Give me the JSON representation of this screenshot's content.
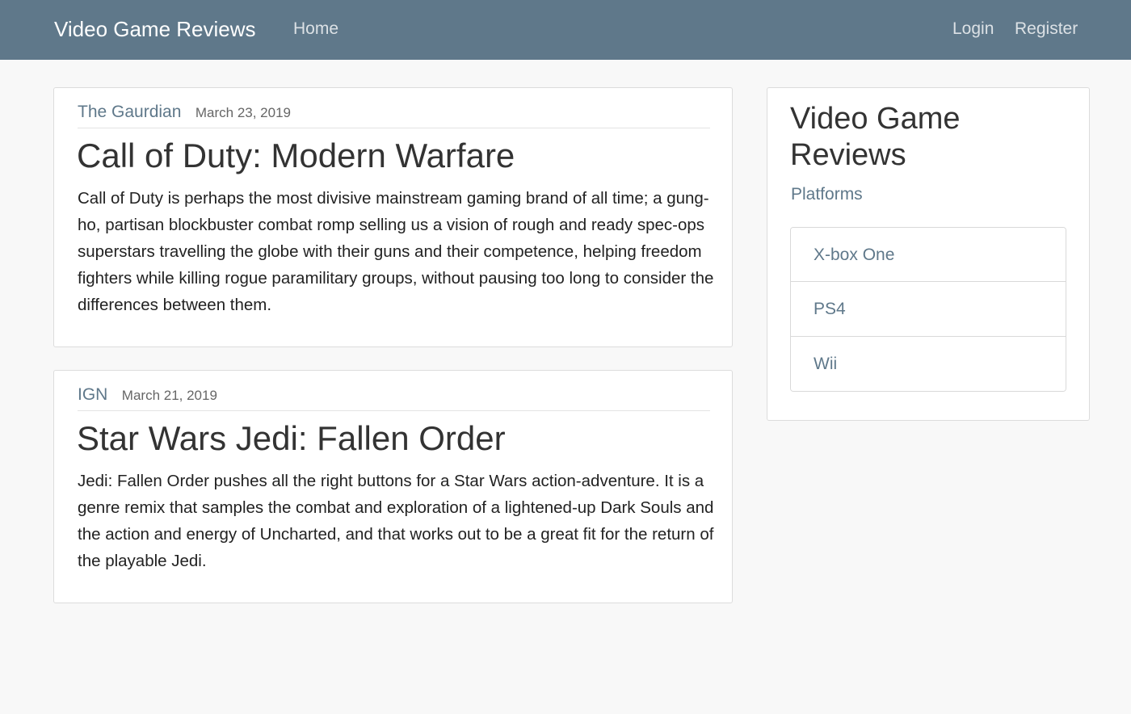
{
  "navbar": {
    "brand": "Video Game Reviews",
    "home": "Home",
    "login": "Login",
    "register": "Register"
  },
  "articles": [
    {
      "author": "The Gaurdian",
      "date": "March 23, 2019",
      "title": "Call of Duty: Modern Warfare",
      "body": "Call of Duty is perhaps the most divisive mainstream gaming brand of all time; a gung-ho, partisan blockbuster combat romp selling us a vision of rough and ready spec-ops superstars travelling the globe with their guns and their competence, helping freedom fighters while killing rogue paramilitary groups, without pausing too long to consider the differences between them."
    },
    {
      "author": "IGN",
      "date": "March 21, 2019",
      "title": "Star Wars Jedi: Fallen Order",
      "body": "Jedi: Fallen Order pushes all the right buttons for a Star Wars action-adventure. It is a genre remix that samples the combat and exploration of a lightened-up Dark Souls and the action and energy of Uncharted, and that works out to be a great fit for the return of the playable Jedi."
    }
  ],
  "sidebar": {
    "title": "Video Game Reviews",
    "subtitle": "Platforms",
    "platforms": [
      "X-box One",
      "PS4",
      "Wii"
    ]
  },
  "colors": {
    "navbar": "#5f788a",
    "accent": "#5f788a",
    "background": "#f8f8f8"
  }
}
